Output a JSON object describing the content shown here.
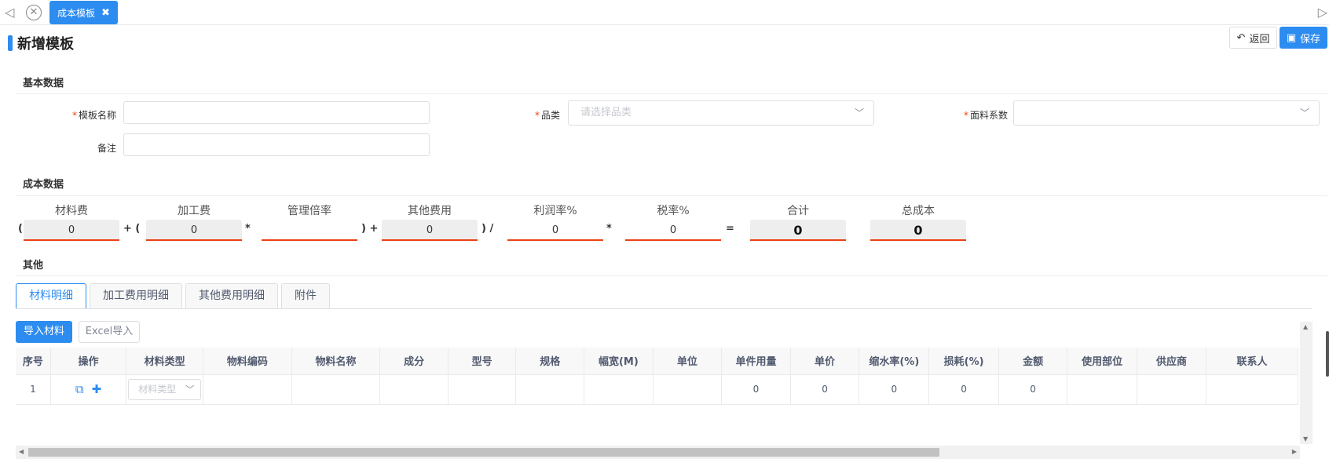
{
  "tabbar": {
    "active_tab": "成本模板",
    "close_glyph": "✖"
  },
  "header": {
    "title": "新增模板",
    "back_label": "返回",
    "save_label": "保存"
  },
  "basic": {
    "section_title": "基本数据",
    "template_name_label": "模板名称",
    "category_label": "品类",
    "category_placeholder": "请选择品类",
    "fabric_coef_label": "面料系数",
    "remark_label": "备注",
    "required_mark": "*"
  },
  "cost": {
    "section_title": "成本数据",
    "items": [
      {
        "label": "材料费",
        "value": "0"
      },
      {
        "label": "加工费",
        "value": "0"
      },
      {
        "label": "管理倍率",
        "value": ""
      },
      {
        "label": "其他费用",
        "value": "0"
      },
      {
        "label": "利润率%",
        "value": "0"
      },
      {
        "label": "税率%",
        "value": "0"
      },
      {
        "label": "合计",
        "value": "0"
      },
      {
        "label": "总成本",
        "value": "0"
      }
    ],
    "ops": [
      "(",
      "+ (",
      "*",
      ") +",
      ") /",
      "*",
      "="
    ]
  },
  "other": {
    "section_title": "其他",
    "tabs": [
      "材料明细",
      "加工费用明细",
      "其他费用明细",
      "附件"
    ],
    "import_label": "导入材料",
    "excel_label": "Excel导入"
  },
  "table": {
    "columns": [
      "序号",
      "操作",
      "材料类型",
      "物料编码",
      "物料名称",
      "成分",
      "型号",
      "规格",
      "幅宽(M)",
      "单位",
      "单件用量",
      "单价",
      "缩水率(%)",
      "损耗(%)",
      "金额",
      "使用部位",
      "供应商",
      "联系人"
    ],
    "row": {
      "index": "1",
      "material_type_placeholder": "材料类型",
      "unit_usage": "0",
      "unit_price": "0",
      "shrink_rate": "0",
      "loss": "0",
      "amount": "0"
    }
  },
  "colors": {
    "primary": "#2d8cf0",
    "required": "#ed4014"
  }
}
